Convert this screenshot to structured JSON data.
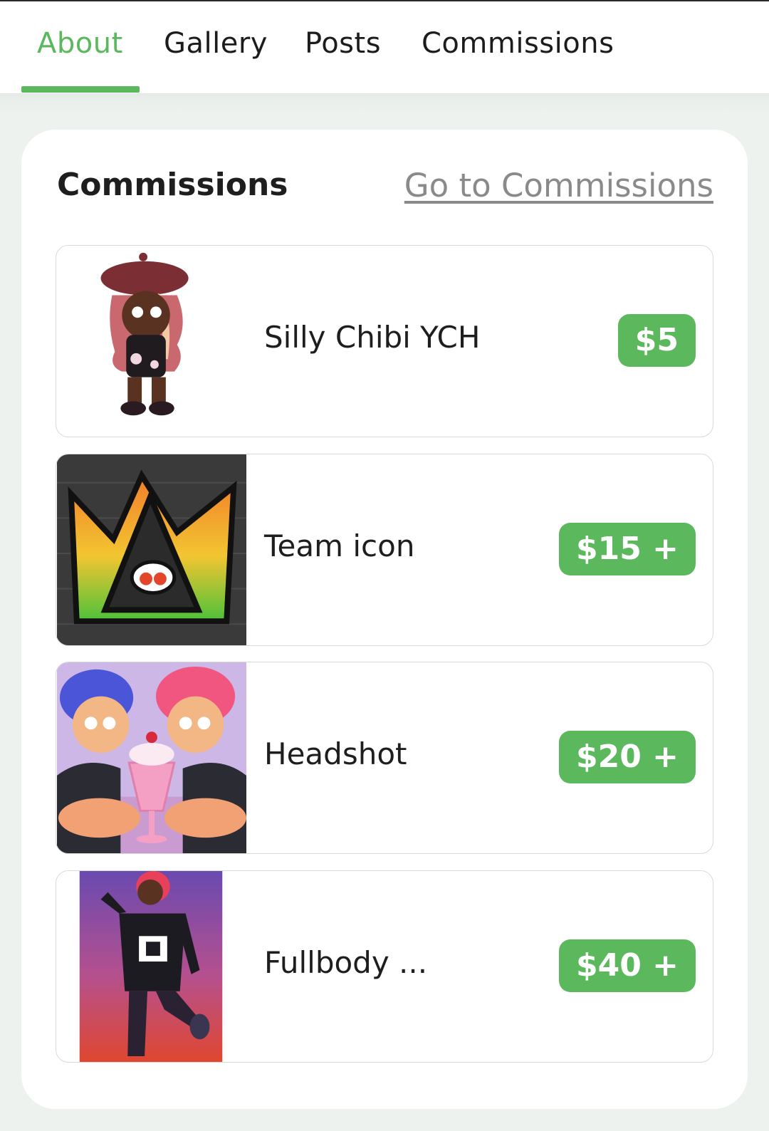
{
  "tabs": [
    {
      "label": "About",
      "active": true
    },
    {
      "label": "Gallery",
      "active": false
    },
    {
      "label": "Posts",
      "active": false
    },
    {
      "label": "Commissions",
      "active": false
    }
  ],
  "section": {
    "title": "Commissions",
    "link": "Go to Commissions"
  },
  "commissions": [
    {
      "name": "Silly Chibi YCH",
      "price": "$5",
      "thumbnail": "chibi-character-art"
    },
    {
      "name": "Team icon",
      "price": "$15 +",
      "thumbnail": "graffiti-crown-logo-art"
    },
    {
      "name": "Headshot",
      "price": "$20 +",
      "thumbnail": "two-characters-milkshake-art"
    },
    {
      "name": "Fullbody ...",
      "price": "$40 +",
      "thumbnail": "fullbody-character-art"
    }
  ],
  "colors": {
    "accent": "#5cb85c",
    "card": "#ffffff",
    "page": "#eef2ef"
  }
}
